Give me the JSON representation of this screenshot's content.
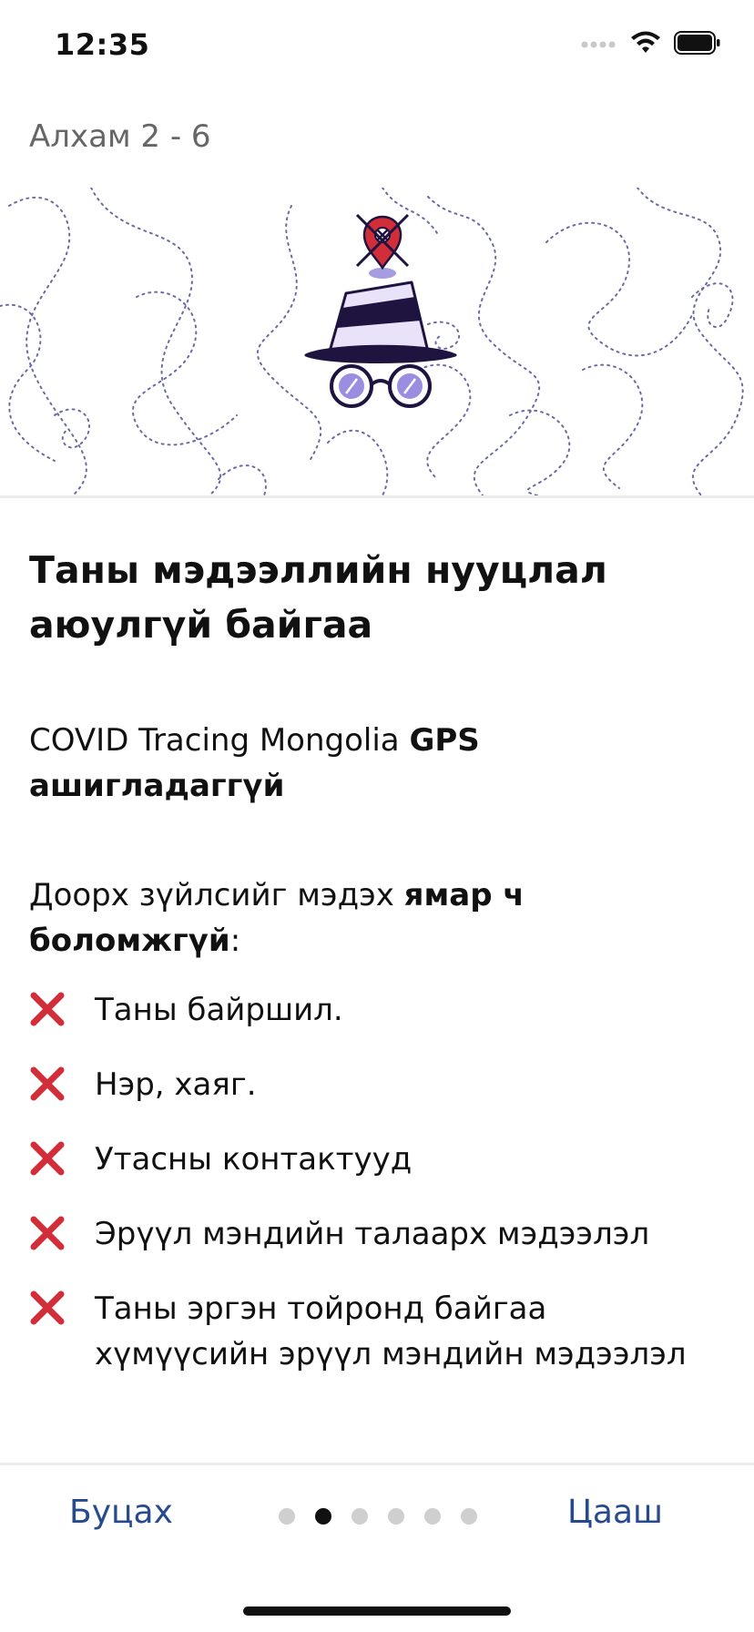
{
  "status_bar": {
    "time": "12:35"
  },
  "header": {
    "step": "Алхам 2  -  6"
  },
  "content": {
    "title": "Таны мэдээллийн нууцлал аюулгүй байгаа",
    "p1_normal": "COVID Tracing Mongolia ",
    "p1_bold": "GPS ашигладаггүй",
    "p2_normal": "Доорх зүйлсийг мэдэх ",
    "p2_bold": "ямар ч боломжгүй",
    "p2_suffix": ":",
    "items": [
      "Таны байршил.",
      "Нэр, хаяг.",
      "Утасны контактууд",
      "Эрүүл мэндийн талаарх мэдээлэл",
      "Таны эргэн тойронд байгаа хүмүүсийн эрүүл мэндийн мэдээлэл"
    ]
  },
  "nav": {
    "back": "Буцах",
    "next": "Цааш",
    "pages_total": 6,
    "active_page": 2
  },
  "colors": {
    "accent": "#274a8f",
    "x_mark": "#d12e3a",
    "hat_dark": "#1f1340",
    "hat_light": "#e9e3fa",
    "lens": "#9b8ee0"
  }
}
